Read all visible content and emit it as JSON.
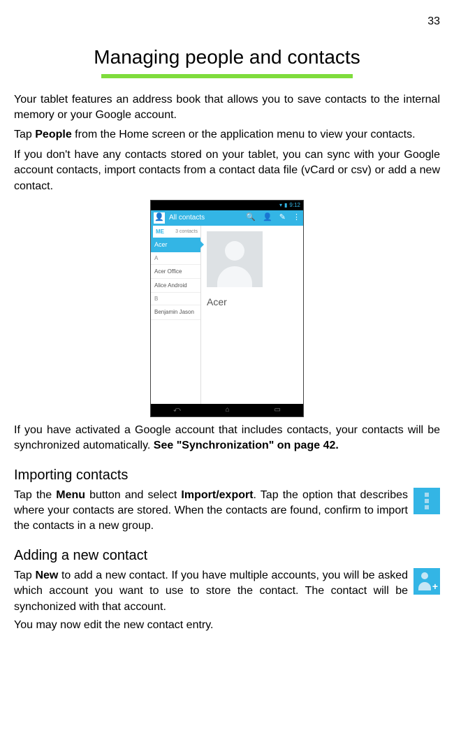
{
  "page_number": "33",
  "title": "Managing people and contacts",
  "paragraphs": {
    "p1": "Your tablet features an address book that allows you to save contacts to the internal memory or your Google account.",
    "p2_prefix": "Tap ",
    "p2_bold": "People",
    "p2_suffix": " from the Home screen or the application menu to view your contacts.",
    "p3": "If you don't have any contacts stored on your tablet, you can sync with your Google account contacts, import contacts from a contact data file (vCard or csv) or add a new contact.",
    "p4_prefix": "If you have activated a Google account that includes contacts, your contacts will be synchronized automatically. ",
    "p4_bold": "See \"Synchronization\" on page 42."
  },
  "screenshot": {
    "status_time": "9:12",
    "app_bar_title": "All contacts",
    "sidebar": {
      "me_label": "ME",
      "me_count": "3 contacts",
      "selected": "Acer",
      "letter_a": "A",
      "item_acer_office": "Acer Office",
      "item_alice": "Alice Android",
      "letter_b": "B",
      "item_benjamin": "Benjamin Jason"
    },
    "contact_name": "Acer"
  },
  "sections": {
    "importing": {
      "heading": "Importing contacts",
      "text_prefix": "Tap the ",
      "text_bold1": "Menu",
      "text_mid": " button and select ",
      "text_bold2": "Import/export",
      "text_suffix": ". Tap the option that describes where your contacts are stored. When the contacts are found, confirm to import the contacts in a new group."
    },
    "adding": {
      "heading": "Adding a new contact",
      "text_prefix": "Tap ",
      "text_bold": "New",
      "text_suffix": " to add a new contact. If you have multiple accounts, you will be asked which account you want to use to store the contact. The contact will be synchonized with that account.",
      "text_final": "You may now edit the new contact entry."
    }
  }
}
